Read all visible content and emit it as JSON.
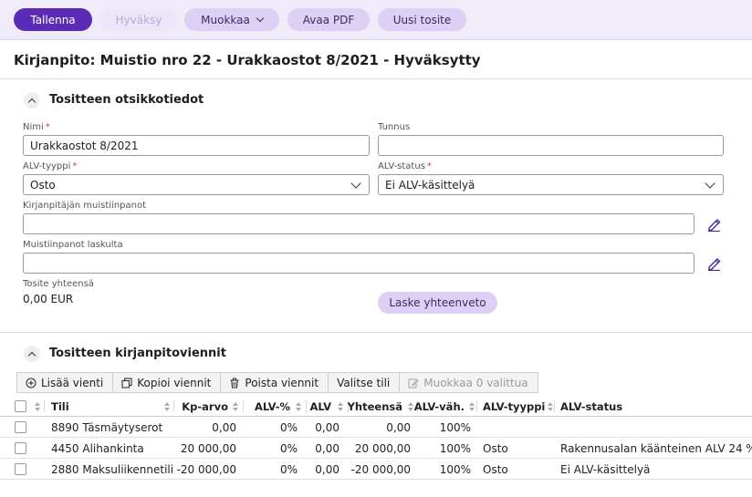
{
  "toolbar": {
    "save": "Tallenna",
    "approve": "Hyväksy",
    "edit": "Muokkaa",
    "open_pdf": "Avaa PDF",
    "new_voucher": "Uusi tosite"
  },
  "page_title": "Kirjanpito: Muistio nro 22 - Urakkaostot 8/2021 - Hyväksytty",
  "header_section": {
    "title": "Tositteen otsikkotiedot",
    "name_label": "Nimi",
    "name_value": "Urakkaostot 8/2021",
    "code_label": "Tunnus",
    "code_value": "",
    "vat_type_label": "ALV-tyyppi",
    "vat_type_value": "Osto",
    "vat_status_label": "ALV-status",
    "vat_status_value": "Ei ALV-käsittelyä",
    "accountant_notes_label": "Kirjanpitäjän muistiinpanot",
    "accountant_notes_value": "",
    "invoice_notes_label": "Muistiinpanot laskulta",
    "invoice_notes_value": "",
    "total_label": "Tosite yhteensä",
    "total_value": "0,00 EUR",
    "summary_button": "Laske yhteenveto",
    "required_mark": "*"
  },
  "entries_section": {
    "title": "Tositteen kirjanpitoviennit",
    "buttons": {
      "add": "Lisää vienti",
      "copy": "Kopioi viennit",
      "delete": "Poista viennit",
      "select_all": "Valitse tili",
      "edit_selected": "Muokkaa 0 valittua"
    },
    "columns": {
      "account": "Tili",
      "kp_value": "Kp-arvo",
      "vat_pct": "ALV-%",
      "vat": "ALV",
      "total": "Yhteensä",
      "vat_deduction": "ALV-väh.",
      "vat_type": "ALV-tyyppi",
      "vat_status": "ALV-status"
    },
    "rows": [
      {
        "account": "8890 Täsmäytyserot",
        "kp_value": "0,00",
        "vat_pct": "0%",
        "vat": "0,00",
        "total": "0,00",
        "vat_deduction": "100%",
        "vat_type": "",
        "vat_status": ""
      },
      {
        "account": "4450 Alihankinta",
        "kp_value": "20 000,00",
        "vat_pct": "0%",
        "vat": "0,00",
        "total": "20 000,00",
        "vat_deduction": "100%",
        "vat_type": "Osto",
        "vat_status": "Rakennusalan käänteinen ALV 24 %"
      },
      {
        "account": "2880 Maksuliikennetili",
        "kp_value": "-20 000,00",
        "vat_pct": "0%",
        "vat": "0,00",
        "total": "-20 000,00",
        "vat_deduction": "100%",
        "vat_type": "Osto",
        "vat_status": "Ei ALV-käsittelyä"
      }
    ]
  },
  "colors": {
    "primary": "#5b2bb5",
    "toolbar_bg": "#f0ebf9",
    "secondary_button": "#ddd0f5",
    "link_icon": "#4a2a9a"
  }
}
